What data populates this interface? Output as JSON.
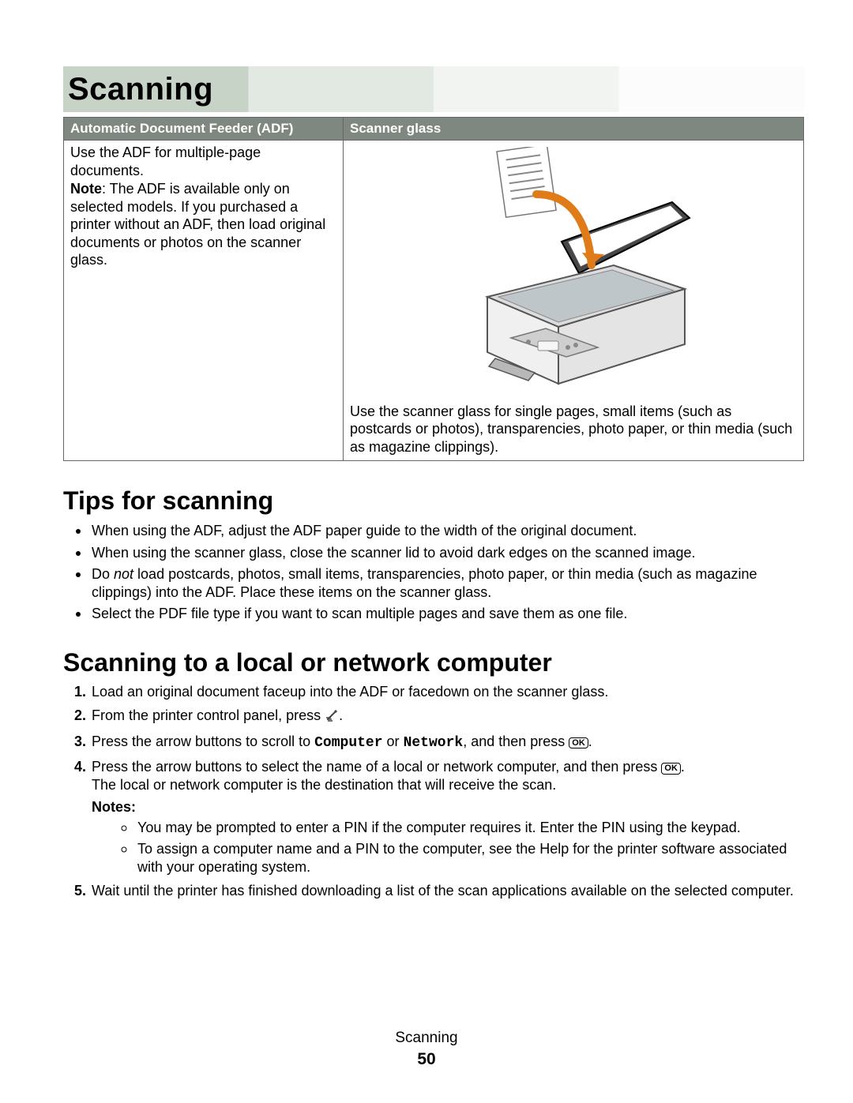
{
  "chapter_title": "Scanning",
  "table": {
    "headers": {
      "adf": "Automatic Document Feeder (ADF)",
      "glass": "Scanner glass"
    },
    "adf": {
      "line1": "Use the ADF for multiple-page documents.",
      "note_label": "Note",
      "note_text": ": The ADF is available only on selected models. If you purchased a printer without an ADF, then load original documents or photos on the scanner glass."
    },
    "glass": {
      "caption": "Use the scanner glass for single pages, small items (such as postcards or photos), transparencies, photo paper, or thin media (such as magazine clippings)."
    }
  },
  "tips": {
    "heading": "Tips for scanning",
    "items": [
      "When using the ADF, adjust the ADF paper guide to the width of the original document.",
      "When using the scanner glass, close the scanner lid to avoid dark edges on the scanned image.",
      "Do not load postcards, photos, small items, transparencies, photo paper, or thin media (such as magazine clippings) into the ADF. Place these items on the scanner glass.",
      "Select the PDF file type if you want to scan multiple pages and save them as one file."
    ],
    "not_word": "not"
  },
  "scan_to": {
    "heading": "Scanning to a local or network computer",
    "step1": "Load an original document faceup into the ADF or facedown on the scanner glass.",
    "step2a": "From the printer control panel, press ",
    "step2b": ".",
    "step3a": "Press the arrow buttons to scroll to ",
    "step3_computer": "Computer",
    "step3_or": " or ",
    "step3_network": "Network",
    "step3b": ", and then press ",
    "step3c": ".",
    "step4a": "Press the arrow buttons to select the name of a local or network computer, and then press ",
    "step4b": ".",
    "step4_line2": "The local or network computer is the destination that will receive the scan.",
    "notes_label": "Notes:",
    "note1": "You may be prompted to enter a PIN if the computer requires it. Enter the PIN using the keypad.",
    "note2": "To assign a computer name and a PIN to the computer, see the Help for the printer software associated with your operating system.",
    "step5": "Wait until the printer has finished downloading a list of the scan applications available on the selected computer."
  },
  "ok_label": "OK",
  "footer": {
    "title": "Scanning",
    "page": "50"
  }
}
